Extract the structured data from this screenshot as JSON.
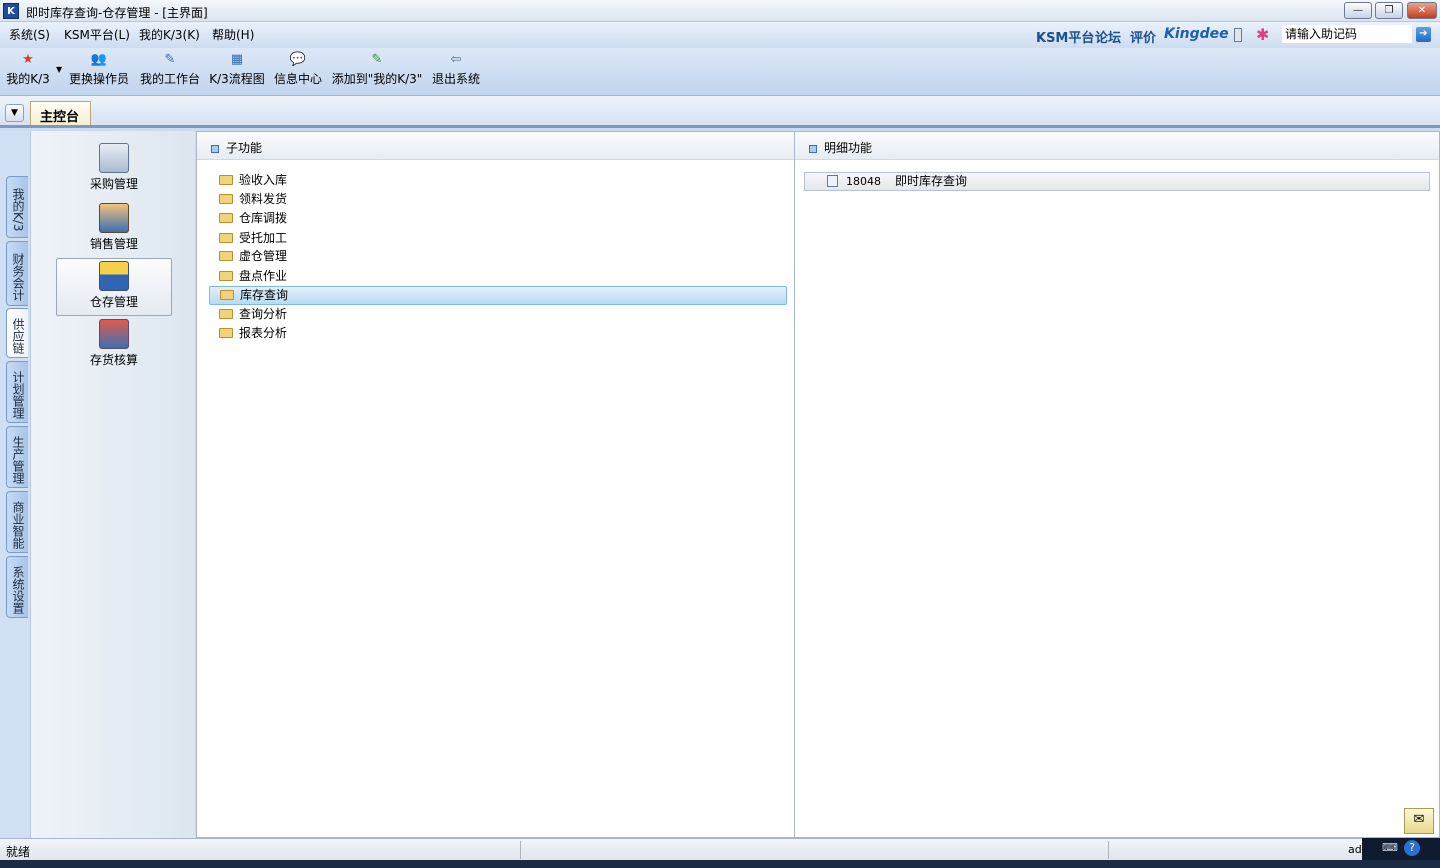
{
  "window": {
    "title": "即时库存查询-仓存管理 - [主界面]",
    "app_icon": "K",
    "minimize": "—",
    "restore": "❐",
    "close": "✕"
  },
  "menu": {
    "items": [
      "系统(S)",
      "KSM平台(L)",
      "我的K/3(K)",
      "帮助(H)"
    ],
    "links": [
      "KSM平台",
      "论坛",
      "评价"
    ],
    "brand": "Kingdee",
    "search_placeholder": "请输入助记码",
    "go_icon": "➔"
  },
  "toolbar": {
    "buttons": [
      {
        "label": "我的K/3",
        "icon": "★",
        "color": "#d93a2b"
      },
      {
        "label": "更换操作员",
        "icon": "👥",
        "color": "#7a3db8"
      },
      {
        "label": "我的工作台",
        "icon": "✎",
        "color": "#3b6ea8"
      },
      {
        "label": "K/3流程图",
        "icon": "▦",
        "color": "#2e6aa8"
      },
      {
        "label": "信息中心",
        "icon": "💬",
        "color": "#c28a1b"
      },
      {
        "label": "添加到\"我的K/3\"",
        "icon": "✎",
        "color": "#3b8a3f"
      },
      {
        "label": "退出系统",
        "icon": "⇦",
        "color": "#4a6f98"
      }
    ]
  },
  "tabs": {
    "main": "主控台"
  },
  "side_tabs": [
    "我的K/3",
    "财务会计",
    "供应链",
    "计划管理",
    "生产管理",
    "商业智能",
    "系统设置"
  ],
  "modules": [
    {
      "label": "采购管理",
      "icon": "purchase-icon"
    },
    {
      "label": "销售管理",
      "icon": "sales-icon"
    },
    {
      "label": "仓存管理",
      "icon": "warehouse-icon"
    },
    {
      "label": "存货核算",
      "icon": "inventory-costing-icon"
    }
  ],
  "subfunctions": {
    "title": "子功能",
    "items": [
      "验收入库",
      "领料发货",
      "仓库调拨",
      "受托加工",
      "虚仓管理",
      "盘点作业",
      "库存查询",
      "查询分析",
      "报表分析"
    ],
    "selected": "库存查询"
  },
  "details": {
    "title": "明细功能",
    "items": [
      {
        "code": "18048",
        "name": "即时库存查询"
      }
    ]
  },
  "status": {
    "text": "就绪",
    "user_fragment": "ad"
  }
}
